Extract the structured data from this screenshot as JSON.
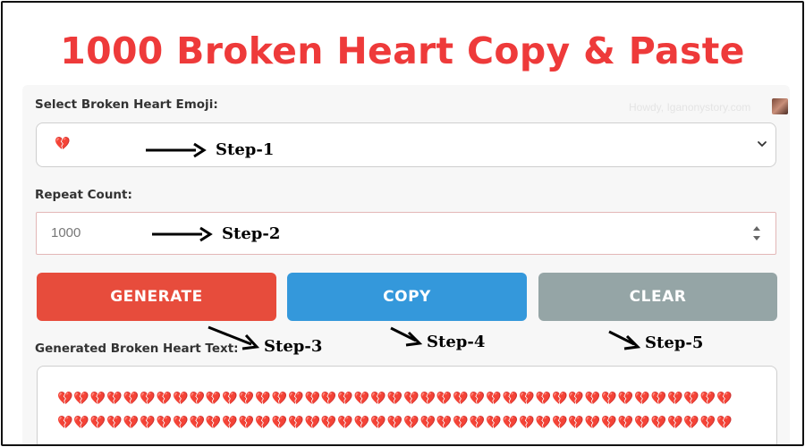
{
  "page": {
    "title": "1000 Broken Heart Copy & Paste",
    "howdy": "Howdy, Iganonystory.com"
  },
  "emoji_select": {
    "label": "Select Broken Heart Emoji:",
    "selected_value": "💔"
  },
  "repeat": {
    "label": "Repeat Count:",
    "value": "1000"
  },
  "buttons": {
    "generate": "GENERATE",
    "copy": "COPY",
    "clear": "CLEAR"
  },
  "output": {
    "label": "Generated Broken Heart Text:",
    "line1": "💔💔💔💔💔💔💔💔💔💔💔💔💔💔💔💔💔💔💔💔💔💔💔💔💔💔💔💔💔💔💔💔💔💔💔💔💔💔💔💔💔",
    "line2": "💔💔💔💔💔💔💔💔💔💔💔💔💔💔💔💔💔💔💔💔💔💔💔💔💔💔💔💔💔💔💔💔💔💔💔💔💔💔💔💔💔"
  },
  "steps": {
    "s1": "Step-1",
    "s2": "Step-2",
    "s3": "Step-3",
    "s4": "Step-4",
    "s5": "Step-5"
  },
  "icons": {
    "select_chevron": "chevron-down-icon",
    "number_spinner": "spinner-arrows-icon",
    "annotation_arrow": "arrow-right-icon"
  },
  "colors": {
    "title": "#ee3a3a",
    "generate": "#e74c3c",
    "copy": "#3498db",
    "clear": "#95a5a6",
    "heart": "#c0262d"
  }
}
